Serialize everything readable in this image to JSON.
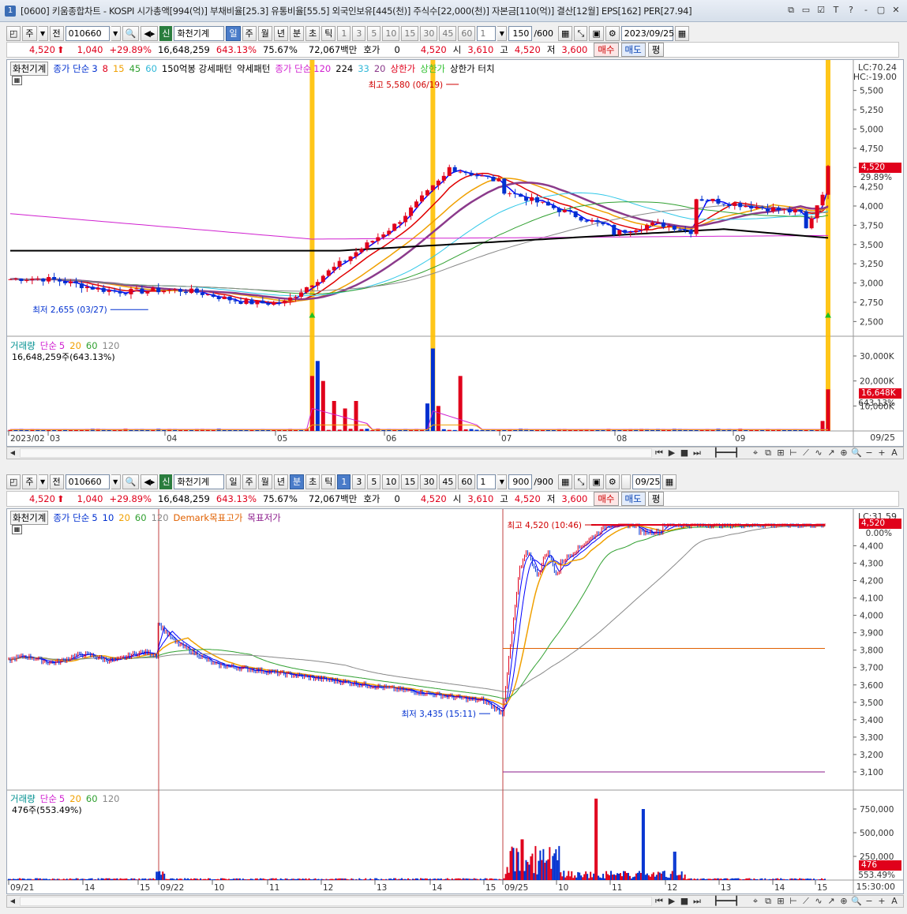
{
  "window": {
    "title": "[0600] 키움종합차트 - KOSPI 시가총액[994(억)] 부채비율[25.3] 유통비율[55.5] 외국인보유[445(천)] 주식수[22,000(천)] 자본금[110(억)] 결산[12월] EPS[162] PER[27.94]",
    "number": "1",
    "buttons": [
      "⧉",
      "▭",
      "☑",
      "T",
      "?",
      "‑",
      "▢",
      "✕"
    ]
  },
  "top": {
    "toolbar": {
      "type": "주",
      "prev": "전",
      "code": "010660",
      "stock_name": "화천기계",
      "sin": "신",
      "periods": [
        "일",
        "주",
        "월",
        "년",
        "분",
        "초",
        "틱"
      ],
      "active_period": "일",
      "numbers": [
        "1",
        "3",
        "5",
        "10",
        "15",
        "30",
        "45",
        "60"
      ],
      "count_value": "1",
      "range": "150",
      "range_max": "/600",
      "date": "2023/09/25"
    },
    "quote": {
      "price": "4,520",
      "change": "1,040",
      "change_pct": "+29.89%",
      "volume": "16,648,259",
      "vol_ratio": "643.13%",
      "turnover": "75.67%",
      "amount": "72,067백만",
      "hoga_label": "호가",
      "hoga_value": "0",
      "cur": "4,520",
      "open_label": "시",
      "open": "3,610",
      "high_label": "고",
      "high": "4,520",
      "low_label": "저",
      "low": "3,600",
      "buy": "매수",
      "sell": "매도",
      "eval": "평"
    },
    "price_legend": {
      "name": "화천기계",
      "ma_label": "종가 단순",
      "ma_periods": [
        "3",
        "8",
        "15",
        "45",
        "60"
      ],
      "pattern1": "150억봉 강세패턴",
      "pattern2": "약세패턴",
      "ma2_label": "종가 단순",
      "ma2_periods": [
        "120",
        "224",
        "33",
        "20"
      ],
      "upper": "상한가",
      "upper2": "상한가",
      "upper_touch": "상한가 터치"
    },
    "lc": "LC:70.24",
    "hc": "HC:-19.00",
    "price_axis": [
      "5,500",
      "5,250",
      "5,000",
      "4,750",
      "4,500",
      "4,250",
      "4,000",
      "3,750",
      "3,500",
      "3,250",
      "3,000",
      "2,750",
      "2,500"
    ],
    "price_tag": "4,520",
    "price_tag_pct": "29.89%",
    "high_note": "최고 5,580 (06/19)",
    "low_note": "최저 2,655 (03/27)",
    "volume_legend": {
      "label": "거래량",
      "ma": "단순",
      "periods": [
        "5",
        "20",
        "60",
        "120"
      ],
      "value": "16,648,259주(643.13%)"
    },
    "volume_axis": [
      "30,000K",
      "20,000K",
      "10,000K"
    ],
    "vol_tag": "16,648K",
    "vol_tag_pct": "643.13%",
    "x_axis": [
      "2023/02",
      "03",
      "04",
      "05",
      "06",
      "07",
      "08",
      "09"
    ],
    "x_axis_end": "09/25"
  },
  "bottom": {
    "toolbar": {
      "type": "주",
      "prev": "전",
      "code": "010660",
      "stock_name": "화천기계",
      "sin": "신",
      "periods": [
        "일",
        "주",
        "월",
        "년",
        "분",
        "초",
        "틱"
      ],
      "active_period": "분",
      "numbers": [
        "1",
        "3",
        "5",
        "10",
        "15",
        "30",
        "45",
        "60"
      ],
      "active_number": "1",
      "count_value": "1",
      "range": "900",
      "range_max": "/900",
      "date": "09/25"
    },
    "quote": {
      "price": "4,520",
      "change": "1,040",
      "change_pct": "+29.89%",
      "volume": "16,648,259",
      "vol_ratio": "643.13%",
      "turnover": "75.67%",
      "amount": "72,067백만",
      "hoga_label": "호가",
      "hoga_value": "0",
      "cur": "4,520",
      "open_label": "시",
      "open": "3,610",
      "high_label": "고",
      "high": "4,520",
      "low_label": "저",
      "low": "3,600",
      "buy": "매수",
      "sell": "매도",
      "eval": "평"
    },
    "price_legend": {
      "name": "화천기계",
      "ma_label": "종가 단순",
      "ma_periods": [
        "5",
        "10",
        "20",
        "60",
        "120"
      ],
      "demark_high": "Demark목표고가",
      "demark_low": "목표저가"
    },
    "lc": "LC:31.59",
    "price_axis": [
      "4,400",
      "4,300",
      "4,200",
      "4,100",
      "4,000",
      "3,900",
      "3,800",
      "3,700",
      "3,600",
      "3,500",
      "3,400",
      "3,300",
      "3,200",
      "3,100"
    ],
    "price_tag": "4,520",
    "price_tag_pct": "0.00%",
    "high_note": "최고 4,520 (10:46)",
    "low_note": "최저 3,435 (15:11)",
    "volume_legend": {
      "label": "거래량",
      "ma": "단순",
      "periods": [
        "5",
        "20",
        "60",
        "120"
      ],
      "value": "476주(553.49%)"
    },
    "volume_axis": [
      "750,000",
      "500,000",
      "250,000"
    ],
    "vol_tag": "476",
    "vol_tag_pct": "553.49%",
    "x_axis": [
      "09/21",
      "14",
      "15",
      "09/22",
      "10",
      "11",
      "12",
      "13",
      "14",
      "15",
      "09/25",
      "10",
      "11",
      "12",
      "13",
      "14",
      "15"
    ],
    "x_axis_end": "15:30:00"
  },
  "colors": {
    "up": "#e0001b",
    "down": "#0030d0",
    "highlight": "#ffc000",
    "ma3": "#0000ff",
    "ma8": "#e00000",
    "ma15": "#f0a000",
    "ma45": "#30a030",
    "ma60": "#30c8e8",
    "ma120": "#d020d0",
    "ma224": "#000000",
    "ma20": "#8b3a8b"
  }
}
